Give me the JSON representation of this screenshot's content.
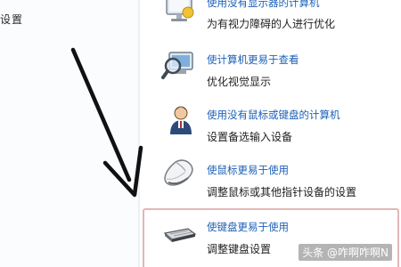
{
  "sidebar": {
    "settings_label": "设置"
  },
  "options": [
    {
      "link": "使用没有显示器的计算机",
      "description": "为有视力障碍的人进行优化",
      "icon": "monitor-icon"
    },
    {
      "link": "使计算机更易于查看",
      "description": "优化视觉显示",
      "icon": "magnifier-icon"
    },
    {
      "link": "使用没有鼠标或键盘的计算机",
      "description": "设置备选输入设备",
      "icon": "person-icon"
    },
    {
      "link": "使鼠标更易于使用",
      "description": "调整鼠标或其他指针设备的设置",
      "icon": "mouse-icon"
    },
    {
      "link": "使键盘更易于使用",
      "description": "调整键盘设置",
      "icon": "keyboard-icon"
    }
  ],
  "watermark": "头条 @咋啊咋啊N",
  "colors": {
    "link": "#1b5fb8",
    "highlight_border": "#e3b6b6",
    "arrow": "#111111"
  }
}
